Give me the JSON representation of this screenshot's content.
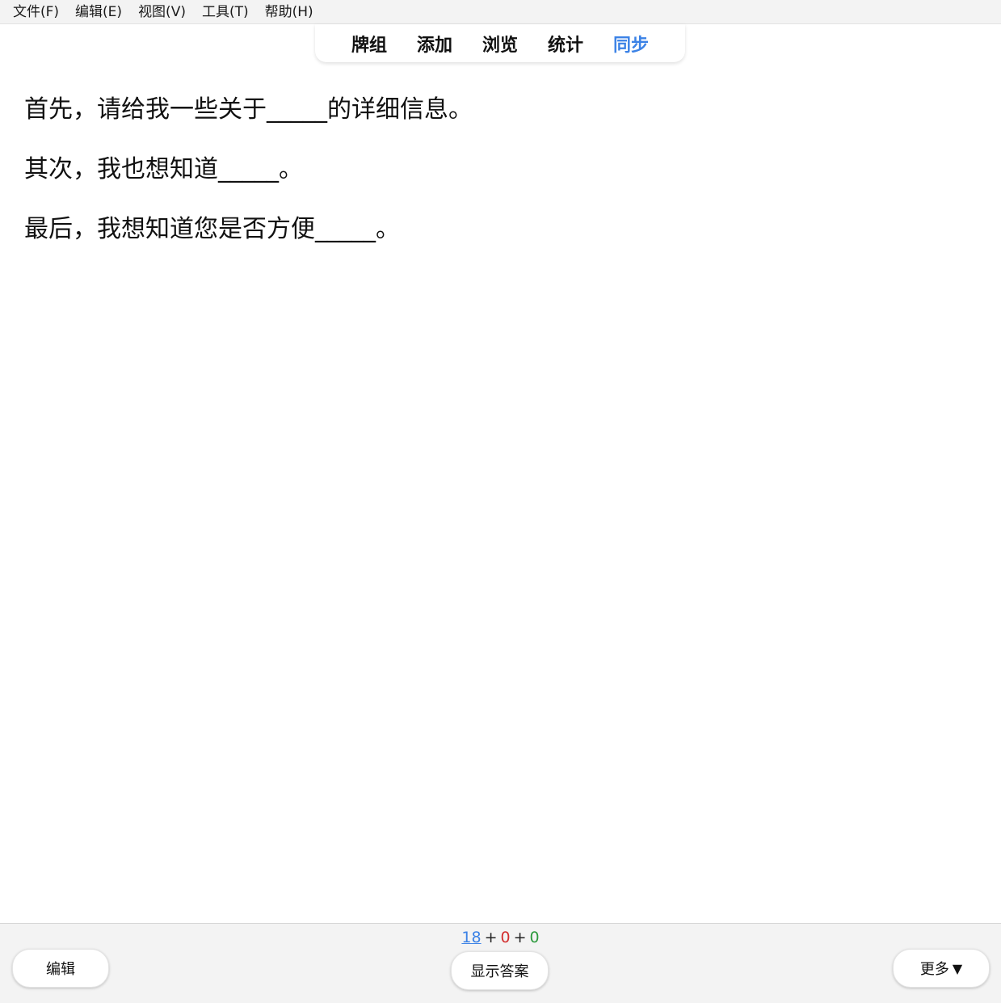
{
  "menu": [
    "文件(F)",
    "编辑(E)",
    "视图(V)",
    "工具(T)",
    "帮助(H)"
  ],
  "toolbar": {
    "items": [
      "牌组",
      "添加",
      "浏览",
      "统计",
      "同步"
    ],
    "active_index": 4,
    "active_color": "#3b82e6"
  },
  "card": {
    "lines": [
      "首先，请给我一些关于_____的详细信息。",
      "其次，我也想知道_____。",
      "最后，我想知道您是否方便_____。"
    ]
  },
  "bottom": {
    "counts": {
      "new": "18",
      "learning": "0",
      "review": "0",
      "separator": "+"
    },
    "count_colors": {
      "new": "#3b82e6",
      "learning": "#d32f2f",
      "review": "#2e9a3e"
    },
    "edit_label": "编辑",
    "show_answer_label": "显示答案",
    "more_label": "更多",
    "more_caret": "▼"
  }
}
